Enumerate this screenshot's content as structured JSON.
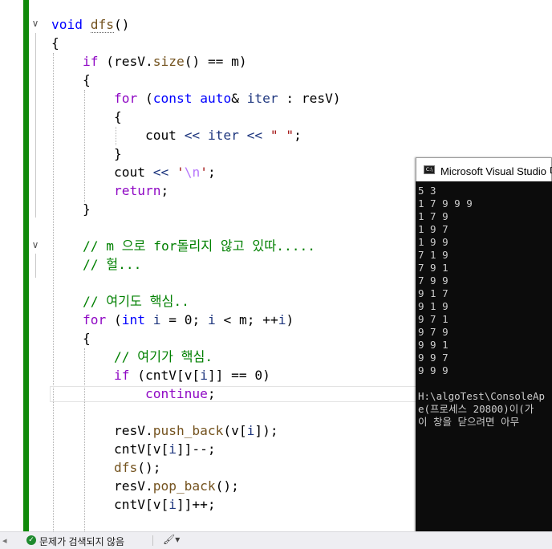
{
  "editor": {
    "lines": [
      [
        [
          "kw",
          "void"
        ],
        [
          "p",
          " "
        ],
        [
          "fn",
          "dfs"
        ],
        [
          "p",
          "()"
        ]
      ],
      [
        [
          "p",
          "{"
        ]
      ],
      [
        [
          "p",
          "    "
        ],
        [
          "ctrl",
          "if"
        ],
        [
          "p",
          " (resV."
        ],
        [
          "fn",
          "size"
        ],
        [
          "p",
          "() == m)"
        ]
      ],
      [
        [
          "p",
          "    {"
        ]
      ],
      [
        [
          "p",
          "        "
        ],
        [
          "ctrl",
          "for"
        ],
        [
          "p",
          " ("
        ],
        [
          "kw",
          "const"
        ],
        [
          "p",
          " "
        ],
        [
          "kw",
          "auto"
        ],
        [
          "p",
          "& "
        ],
        [
          "var",
          "iter"
        ],
        [
          "p",
          " : resV)"
        ]
      ],
      [
        [
          "p",
          "        {"
        ]
      ],
      [
        [
          "p",
          "            cout "
        ],
        [
          "var",
          "<<"
        ],
        [
          "p",
          " "
        ],
        [
          "var",
          "iter"
        ],
        [
          "p",
          " "
        ],
        [
          "var",
          "<<"
        ],
        [
          "p",
          " "
        ],
        [
          "str",
          "\" \""
        ],
        [
          "p",
          ";"
        ]
      ],
      [
        [
          "p",
          "        }"
        ]
      ],
      [
        [
          "p",
          "        cout "
        ],
        [
          "var",
          "<<"
        ],
        [
          "p",
          " "
        ],
        [
          "str",
          "'"
        ],
        [
          "esc",
          "\\n"
        ],
        [
          "str",
          "'"
        ],
        [
          "p",
          ";"
        ]
      ],
      [
        [
          "p",
          "        "
        ],
        [
          "ctrl",
          "return"
        ],
        [
          "p",
          ";"
        ]
      ],
      [
        [
          "p",
          "    }"
        ]
      ],
      [
        [
          "p",
          ""
        ]
      ],
      [
        [
          "p",
          "    "
        ],
        [
          "cmt",
          "// m 으로 for돌리지 않고 있따....."
        ]
      ],
      [
        [
          "p",
          "    "
        ],
        [
          "cmt",
          "// 헐..."
        ]
      ],
      [
        [
          "p",
          ""
        ]
      ],
      [
        [
          "p",
          "    "
        ],
        [
          "cmt",
          "// 여기도 핵심.."
        ]
      ],
      [
        [
          "p",
          "    "
        ],
        [
          "ctrl",
          "for"
        ],
        [
          "p",
          " ("
        ],
        [
          "kw",
          "int"
        ],
        [
          "p",
          " "
        ],
        [
          "var",
          "i"
        ],
        [
          "p",
          " = 0; "
        ],
        [
          "var",
          "i"
        ],
        [
          "p",
          " < m; ++"
        ],
        [
          "var",
          "i"
        ],
        [
          "p",
          ")"
        ]
      ],
      [
        [
          "p",
          "    {"
        ]
      ],
      [
        [
          "p",
          "        "
        ],
        [
          "cmt",
          "// 여기가 핵심."
        ]
      ],
      [
        [
          "p",
          "        "
        ],
        [
          "ctrl",
          "if"
        ],
        [
          "p",
          " (cntV[v["
        ],
        [
          "var",
          "i"
        ],
        [
          "p",
          "]] == 0)"
        ]
      ],
      [
        [
          "p",
          "            "
        ],
        [
          "ctrl",
          "continue"
        ],
        [
          "p",
          ";"
        ]
      ],
      [
        [
          "p",
          ""
        ]
      ],
      [
        [
          "p",
          "        resV."
        ],
        [
          "fn",
          "push_back"
        ],
        [
          "p",
          "(v["
        ],
        [
          "var",
          "i"
        ],
        [
          "p",
          "]);"
        ]
      ],
      [
        [
          "p",
          "        cntV[v["
        ],
        [
          "var",
          "i"
        ],
        [
          "p",
          "]]--;"
        ]
      ],
      [
        [
          "p",
          "        "
        ],
        [
          "fn",
          "dfs"
        ],
        [
          "p",
          "();"
        ]
      ],
      [
        [
          "p",
          "        resV."
        ],
        [
          "fn",
          "pop_back"
        ],
        [
          "p",
          "();"
        ]
      ],
      [
        [
          "p",
          "        cntV[v["
        ],
        [
          "var",
          "i"
        ],
        [
          "p",
          "]]++;"
        ]
      ]
    ],
    "fold_markers": [
      "∨",
      "∨"
    ]
  },
  "console": {
    "title": "Microsoft Visual Studio 디",
    "icon_label": "C:\\",
    "output_lines": [
      "5 3",
      "1 7 9 9 9",
      "1 7 9",
      "1 9 7",
      "1 9 9",
      "7 1 9",
      "7 9 1",
      "7 9 9",
      "9 1 7",
      "9 1 9",
      "9 7 1",
      "9 7 9",
      "9 9 1",
      "9 9 7",
      "9 9 9",
      "",
      "H:\\algoTest\\ConsoleAp",
      "e(프로세스 20800)이(가",
      "이 창을 닫으려면 아무"
    ]
  },
  "status_bar": {
    "zoom_label": "◂",
    "issues_text": "문제가 검색되지 않음",
    "ok_icon": "✓",
    "cleanup_icon": "🖌▾",
    "colors": {
      "ok": "#1e8a2e",
      "gutter": "#108a0a"
    }
  }
}
